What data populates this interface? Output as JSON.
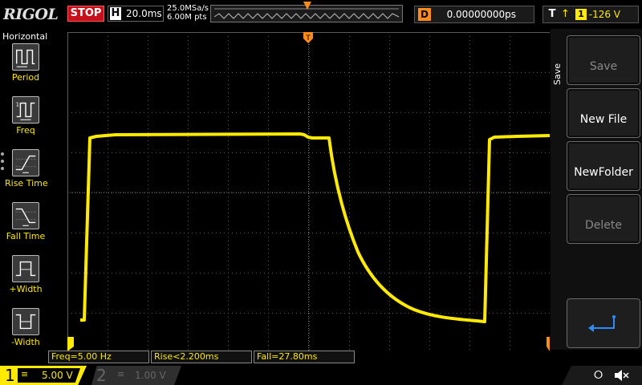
{
  "brand": "RIGOL",
  "status": "STOP",
  "horizontal": {
    "letter": "H",
    "timebase": "20.0ms",
    "sample_rate": "25.0MSa/s",
    "memory_depth": "6.00M pts"
  },
  "delay": {
    "letter": "D",
    "value": "0.00000000ps"
  },
  "trigger": {
    "letter": "T",
    "edge_glyph": "↑",
    "channel": "1",
    "level": "-126 V"
  },
  "left_panel": {
    "title": "Horizontal",
    "items": [
      {
        "label": "Period",
        "icon": "period-icon"
      },
      {
        "label": "Freq",
        "icon": "freq-icon"
      },
      {
        "label": "Rise Time",
        "icon": "rise-time-icon"
      },
      {
        "label": "Fall Time",
        "icon": "fall-time-icon"
      },
      {
        "label": "+Width",
        "icon": "positive-width-icon"
      },
      {
        "label": "-Width",
        "icon": "negative-width-icon"
      }
    ]
  },
  "right_menu": {
    "title": "Save",
    "buttons": [
      {
        "label": "Save",
        "state": "disabled"
      },
      {
        "label": "New File",
        "state": "enabled"
      },
      {
        "label": "NewFolder",
        "state": "enabled"
      },
      {
        "label": "Delete",
        "state": "disabled"
      }
    ],
    "back_icon": "enter-return-icon"
  },
  "measurements": {
    "freq": "Freq=5.00 Hz",
    "rise": "Rise<2.200ms",
    "fall": "Fall=27.80ms"
  },
  "channels": [
    {
      "number": "1",
      "coupling_glyph": "≡",
      "scale": "5.00 V",
      "active": true
    },
    {
      "number": "2",
      "coupling_glyph": "≡",
      "scale": "1.00 V",
      "active": false
    }
  ],
  "colors": {
    "ch1": "#ffea00",
    "trigger_marker": "#ff8c1a",
    "stop": "#c8101b",
    "grid": "#555555"
  }
}
